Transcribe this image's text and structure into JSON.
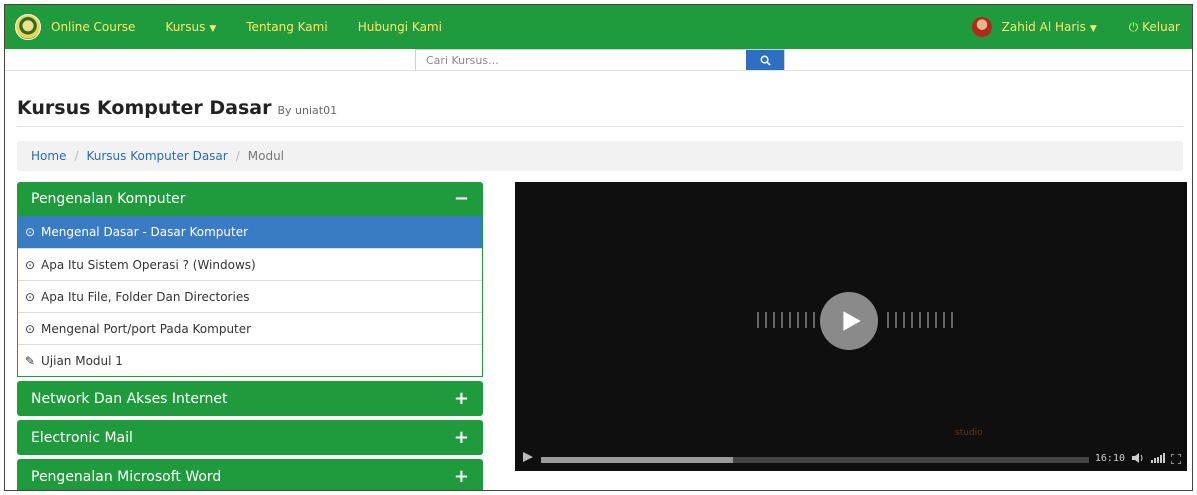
{
  "navbar": {
    "brand": "Online Course",
    "menu": [
      {
        "label": "Kursus",
        "dropdown": true
      },
      {
        "label": "Tentang Kami"
      },
      {
        "label": "Hubungi Kami"
      }
    ],
    "user": "Zahid Al Haris",
    "logout": "Keluar",
    "color": "#1f9a3c",
    "text_color": "#ffe96a"
  },
  "search": {
    "placeholder": "Cari Kursus...",
    "button_icon": "search-icon"
  },
  "course": {
    "title": "Kursus Komputer Dasar",
    "by": "By uniat01"
  },
  "breadcrumb": [
    "Home",
    "Kursus Komputer Dasar",
    "Modul"
  ],
  "modules": [
    {
      "title": "Pengenalan Komputer",
      "expanded": true,
      "lessons": [
        {
          "label": "Mengenal Dasar - Dasar Komputer",
          "icon": "play-circle-icon",
          "active": true
        },
        {
          "label": "Apa Itu Sistem Operasi ? (Windows)",
          "icon": "play-circle-icon"
        },
        {
          "label": "Apa Itu File, Folder Dan Directories",
          "icon": "play-circle-icon"
        },
        {
          "label": "Mengenal Port/port Pada Komputer",
          "icon": "play-circle-icon"
        },
        {
          "label": "Ujian Modul 1",
          "icon": "edit-icon"
        }
      ]
    },
    {
      "title": "Network Dan Akses Internet",
      "expanded": false
    },
    {
      "title": "Electronic Mail",
      "expanded": false
    },
    {
      "title": "Pengenalan Microsoft Word",
      "expanded": false
    }
  ],
  "video": {
    "time": "16:10",
    "progress": 0.35,
    "watermark": "studio"
  }
}
